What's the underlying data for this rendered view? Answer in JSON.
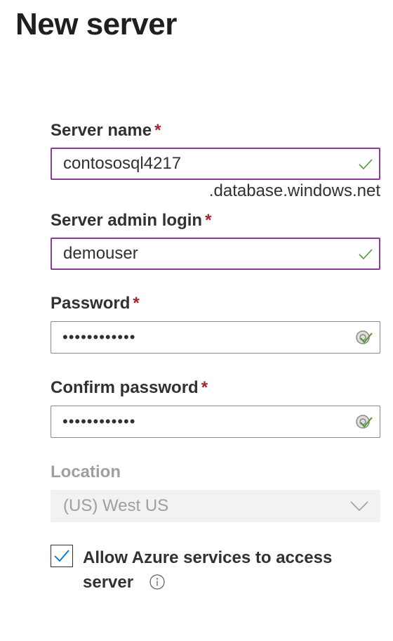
{
  "page": {
    "title": "New server"
  },
  "form": {
    "server_name": {
      "label": "Server name",
      "required": "*",
      "value": "contososql4217",
      "suffix": ".database.windows.net"
    },
    "admin_login": {
      "label": "Server admin login",
      "required": "*",
      "value": "demouser"
    },
    "password": {
      "label": "Password",
      "required": "*",
      "value": "••••••••••••"
    },
    "confirm_password": {
      "label": "Confirm password",
      "required": "*",
      "value": "••••••••••••"
    },
    "location": {
      "label": "Location",
      "value": "(US) West US"
    },
    "allow_azure": {
      "label": "Allow Azure services to access server",
      "checked": true
    }
  },
  "colors": {
    "focus_border": "#8a3c96",
    "valid_check": "#107c10",
    "required": "#a4262c",
    "checkbox_tick": "#0078d4",
    "disabled_text": "#a19f9d"
  },
  "icons": {
    "valid": "check-icon",
    "password_reveal": "password-manager-icon",
    "dropdown": "chevron-down-icon",
    "info": "info-icon",
    "checkbox": "checkmark-icon"
  }
}
